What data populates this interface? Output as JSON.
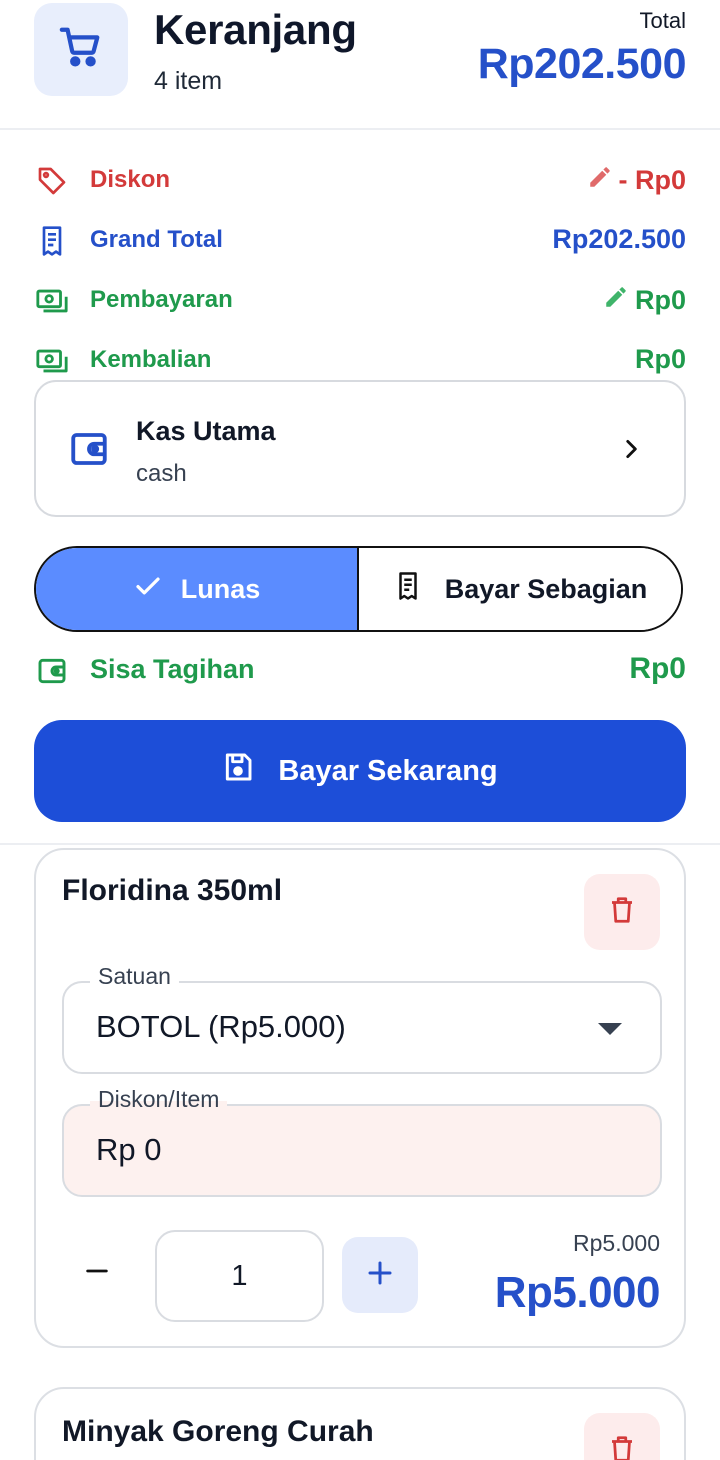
{
  "header": {
    "icon": "shopping-cart-icon",
    "title": "Keranjang",
    "item_count": "4 item",
    "total_label": "Total",
    "total_value": "Rp202.500"
  },
  "summary": {
    "discount": {
      "icon": "tag-icon",
      "label": "Diskon",
      "value": "- Rp0",
      "edit_icon": "pencil-icon",
      "color": "#d33a3a"
    },
    "grand_total": {
      "icon": "receipt-icon",
      "label": "Grand Total",
      "value": "Rp202.500",
      "color": "#2550c9"
    },
    "payment": {
      "icon": "cash-icon",
      "label": "Pembayaran",
      "value": "Rp0",
      "edit_icon": "pencil-icon",
      "color": "#1f9a4c"
    },
    "change": {
      "icon": "cash-icon",
      "label": "Kembalian",
      "value": "Rp0",
      "color": "#1f9a4c"
    }
  },
  "cash_account": {
    "icon": "wallet-icon",
    "name": "Kas Utama",
    "type": "cash",
    "chevron": "chevron-right-icon"
  },
  "payment_mode": {
    "options": [
      {
        "label": "Lunas",
        "icon": "check-icon",
        "selected": true
      },
      {
        "label": "Bayar Sebagian",
        "icon": "receipt-icon",
        "selected": false
      }
    ],
    "accent": "#5b8cff"
  },
  "remaining": {
    "icon": "wallet-icon",
    "label": "Sisa Tagihan",
    "value": "Rp0"
  },
  "pay_button": {
    "icon": "save-icon",
    "label": "Bayar Sekarang",
    "color": "#1d4ed8"
  },
  "cart_items": [
    {
      "name": "Floridina 350ml",
      "unit_label": "Satuan",
      "unit_value": "BOTOL (Rp5.000)",
      "discount_label": "Diskon/Item",
      "discount_value": "Rp 0",
      "quantity": "1",
      "unit_price": "Rp5.000",
      "line_total": "Rp5.000"
    },
    {
      "name": "Minyak Goreng Curah"
    }
  ]
}
